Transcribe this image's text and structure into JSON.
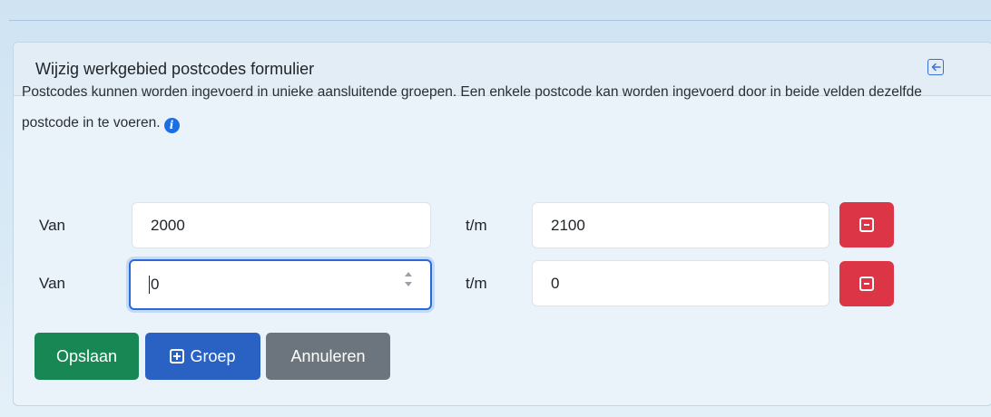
{
  "card": {
    "title": "Wijzig werkgebied postcodes formulier"
  },
  "intro": {
    "text": "Postcodes kunnen worden ingevoerd in unieke aansluitende groepen. Een enkele postcode kan worden ingevoerd door in beide velden dezelfde postcode in te voeren."
  },
  "rows": [
    {
      "from_label": "Van",
      "from_value": "2000",
      "to_label": "t/m",
      "to_value": "2100"
    },
    {
      "from_label": "Van",
      "from_value": "0",
      "to_label": "t/m",
      "to_value": "0"
    }
  ],
  "buttons": {
    "save": "Opslaan",
    "add_group": "Groep",
    "cancel": "Annuleren"
  },
  "icons": {
    "collapse": "collapse-left-icon",
    "info": "info-icon",
    "remove": "minus-square-icon",
    "add": "plus-square-icon"
  },
  "colors": {
    "danger": "#dc3545",
    "success": "#198754",
    "primary": "#2a62c4",
    "secondary": "#6c757d",
    "focus": "#2a6ad8"
  }
}
